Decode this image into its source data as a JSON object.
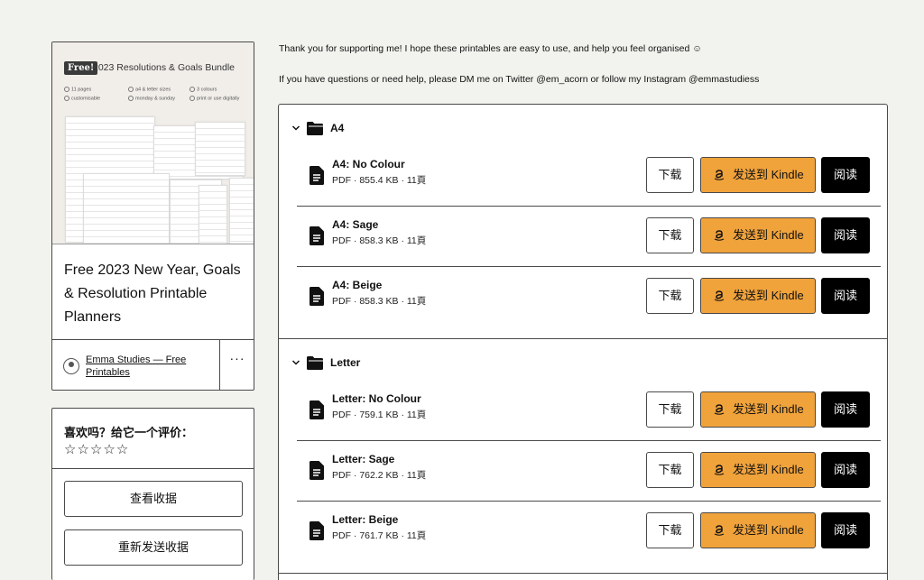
{
  "product": {
    "cover": {
      "badge": "Free!",
      "title": "2023 Resolutions & Goals Bundle",
      "features": [
        "11 pages",
        "a4 & letter sizes",
        "3 colours",
        "customisable",
        "monday & sunday",
        "print or use digitally"
      ]
    },
    "title": "Free 2023 New Year, Goals & Resolution Printable Planners",
    "creator": "Emma Studies — Free Printables",
    "more_label": "···"
  },
  "rating": {
    "title": "喜欢吗？给它一个评价：",
    "stars": [
      "☆",
      "☆",
      "☆",
      "☆",
      "☆"
    ],
    "view_receipt": "查看收据",
    "resend_receipt": "重新发送收据"
  },
  "messages": {
    "thanks": "Thank you for supporting me! I hope these printables are easy to use, and help you feel organised ☺",
    "contact": "If you have questions or need help, please DM me on Twitter @em_acorn or follow my Instagram @emmastudiess"
  },
  "buttons": {
    "download": "下载",
    "kindle": "发送到 Kindle",
    "read": "阅读"
  },
  "folders": [
    {
      "name": "A4",
      "files": [
        {
          "name": "A4: No Colour",
          "meta": "PDF · 855.4 KB · 11頁"
        },
        {
          "name": "A4: Sage",
          "meta": "PDF · 858.3 KB · 11頁"
        },
        {
          "name": "A4: Beige",
          "meta": "PDF · 858.3 KB · 11頁"
        }
      ]
    },
    {
      "name": "Letter",
      "files": [
        {
          "name": "Letter: No Colour",
          "meta": "PDF · 759.1 KB · 11頁"
        },
        {
          "name": "Letter: Sage",
          "meta": "PDF · 762.2 KB · 11頁"
        },
        {
          "name": "Letter: Beige",
          "meta": "PDF · 761.7 KB · 11頁"
        }
      ]
    }
  ],
  "colors": {
    "background": "#f2f2ee",
    "kindle_button": "#f0a23b",
    "read_button": "#000000",
    "border": "#4a4a4a"
  }
}
